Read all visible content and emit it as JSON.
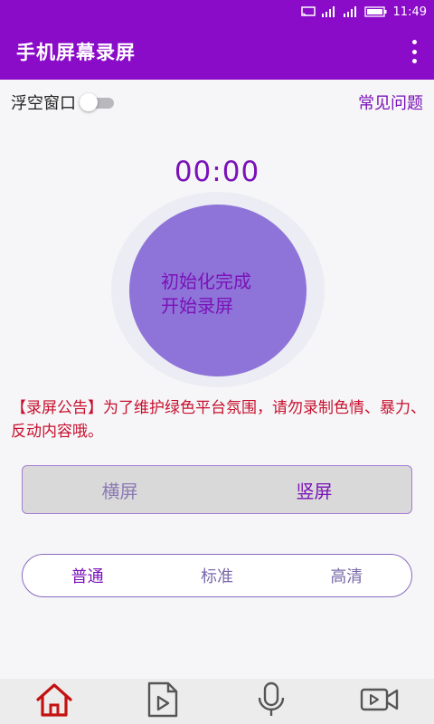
{
  "status_bar": {
    "time": "11:49",
    "icons": [
      "cast-icon",
      "signal-icon",
      "signal-icon",
      "battery-icon"
    ]
  },
  "app_bar": {
    "title": "手机屏幕录屏",
    "menu_icon": "more-vert-icon"
  },
  "floating_window": {
    "label": "浮空窗口",
    "enabled": false
  },
  "faq_link": "常见问题",
  "timer": "00:00",
  "record_button": {
    "line1": "初始化完成",
    "line2": "开始录屏"
  },
  "notice": "【录屏公告】为了维护绿色平台氛围，请勿录制色情、暴力、反动内容哦。",
  "orientation": {
    "options": [
      "横屏",
      "竖屏"
    ],
    "selected": "竖屏"
  },
  "quality": {
    "options": [
      "普通",
      "标准",
      "高清"
    ],
    "selected": "普通"
  },
  "bottom_nav": {
    "items": [
      "home-icon",
      "video-file-icon",
      "microphone-icon",
      "video-camera-icon"
    ],
    "active": "home-icon"
  },
  "colors": {
    "primary": "#8a0cc8",
    "accent_text": "#7a12b8",
    "record_fill": "#8e74d8",
    "notice_red": "#c8102e",
    "nav_active": "#c41212"
  }
}
